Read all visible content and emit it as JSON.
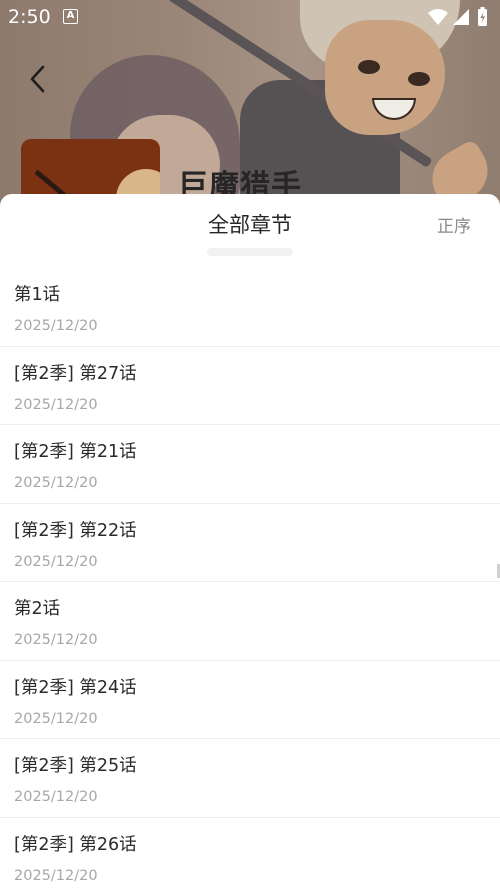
{
  "status_bar": {
    "time": "2:50",
    "badge": "A"
  },
  "header": {
    "title": "巨魔猎手"
  },
  "sheet": {
    "title": "全部章节",
    "order_label": "正序"
  },
  "chapters": [
    {
      "name": "第1话",
      "date": "2025/12/20"
    },
    {
      "name": "[第2季] 第27话",
      "date": "2025/12/20"
    },
    {
      "name": "[第2季] 第21话",
      "date": "2025/12/20"
    },
    {
      "name": "[第2季] 第22话",
      "date": "2025/12/20"
    },
    {
      "name": "第2话",
      "date": "2025/12/20"
    },
    {
      "name": "[第2季] 第24话",
      "date": "2025/12/20"
    },
    {
      "name": "[第2季] 第25话",
      "date": "2025/12/20"
    },
    {
      "name": "[第2季] 第26话",
      "date": "2025/12/20"
    }
  ],
  "icons": {
    "back": "chevron-left-icon",
    "wifi": "wifi-icon",
    "signal": "signal-icon",
    "battery": "battery-icon"
  },
  "colors": {
    "sheet_background": "#ffffff",
    "primary_text": "#2b2b2b",
    "secondary_text": "#a7a7a7",
    "divider": "#efefef"
  }
}
